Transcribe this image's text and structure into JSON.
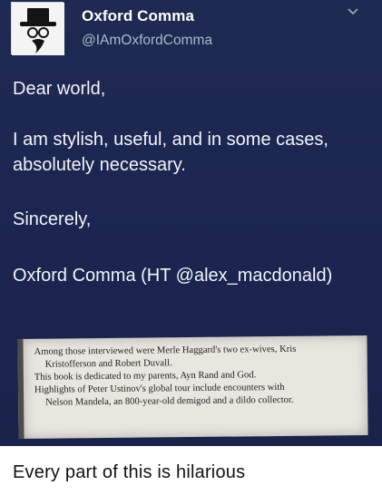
{
  "tweet": {
    "display_name": "Oxford Comma",
    "handle": "@IAmOxfordComma",
    "avatar_icon": "oxford-comma-hat-avatar-icon",
    "menu_icon": "chevron-down-icon",
    "paragraphs": [
      "Dear world,",
      "I am stylish, useful, and in some cases, absolutely necessary.",
      "Sincerely,",
      "Oxford Comma (HT @alex_macdonald)"
    ],
    "image": {
      "lines": [
        "Among those interviewed were Merle Haggard's two ex-wives, Kris",
        "Kristofferson and Robert Duvall.",
        "This book is dedicated to my parents, Ayn Rand and God.",
        "Highlights of Peter Ustinov's global tour include encounters with",
        "Nelson Mandela, an 800-year-old demigod and a dildo collector."
      ]
    },
    "colors": {
      "background": "#1d2750",
      "text": "#f3f4f8",
      "handle": "#aeb6cc"
    }
  },
  "caption": "Every part of this is hilarious"
}
